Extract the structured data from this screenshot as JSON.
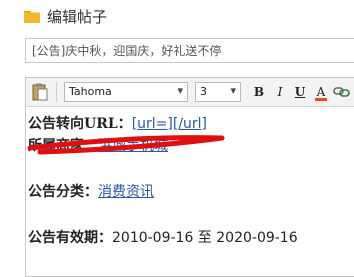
{
  "window": {
    "title": "编辑帖子"
  },
  "subject": {
    "value": "[公告]庆中秋，迎国庆，好礼送不停"
  },
  "toolbar": {
    "paste_icon": "paste-icon",
    "font_family": "Tahoma",
    "font_size": "3",
    "bold_label": "B",
    "italic_label": "I",
    "underline_label": "U",
    "font_color_label": "A",
    "font_color": "#e64a19",
    "link_icon": "link-icon",
    "align_icon": "align-icon"
  },
  "content": {
    "url_label": "公告转向URL：",
    "url_value": "[url=][/url]",
    "merchant_label": "所属商家：",
    "merchant_value": "洪城手机城",
    "category_label": "公告分类：",
    "category_value": "消费资讯",
    "validity_label": "公告有效期：",
    "validity_value": "2010-09-16 至 2020-09-16"
  },
  "colors": {
    "link": "#2a57a8",
    "annotation_stroke": "#e01010",
    "folder": "#f5b731"
  }
}
